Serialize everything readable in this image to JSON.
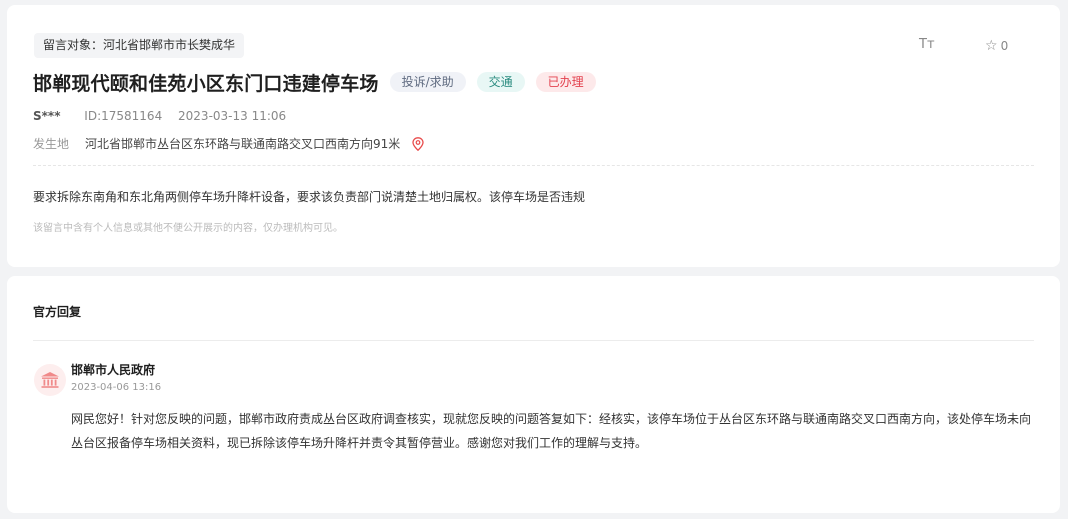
{
  "message": {
    "target_label": "留言对象：",
    "target_value": "河北省邯郸市市长樊成华",
    "title": "邯郸现代颐和佳苑小区东门口违建停车场",
    "tags": {
      "type": "投诉/求助",
      "category": "交通",
      "status": "已办理"
    },
    "font_toggle": "Tт",
    "favorite_count": "0",
    "user": "S***",
    "id": "ID:17581164",
    "datetime": "2023-03-13 11:06",
    "location_label": "发生地",
    "location": "河北省邯郸市丛台区东环路与联通南路交叉口西南方向91米",
    "content": "要求拆除东南角和东北角两侧停车场升降杆设备，要求该负责部门说清楚土地归属权。该停车场是否违规",
    "notice": "该留言中含有个人信息或其他不便公开展示的内容，仅办理机构可见。"
  },
  "reply": {
    "heading": "官方回复",
    "org": "邯郸市人民政府",
    "date": "2023-04-06 13:16",
    "text": "网民您好！针对您反映的问题，邯郸市政府责成丛台区政府调查核实，现就您反映的问题答复如下：经核实，该停车场位于丛台区东环路与联通南路交叉口西南方向，该处停车场未向丛台区报备停车场相关资料，现已拆除该停车场升降杆并责令其暂停营业。感谢您对我们工作的理解与支持。"
  },
  "colors": {
    "status_red": "#e3424f",
    "category_teal": "#2b8c80",
    "pin_red": "#e84b4b"
  },
  "icons": {
    "font_size": "font-size-icon",
    "favorite": "star-outline-icon",
    "location": "map-pin-icon",
    "avatar": "government-building-icon"
  }
}
